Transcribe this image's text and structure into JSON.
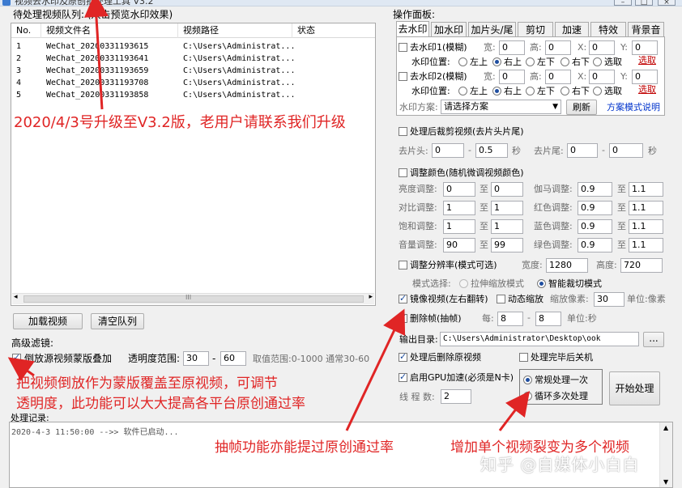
{
  "window": {
    "title": "视频去水印及原创批处理工具 V3.2"
  },
  "queue": {
    "label": "待处理视频队列: (双击预览水印效果)",
    "columns": [
      "No.",
      "视频文件名",
      "视频路径",
      "状态"
    ],
    "rows": [
      [
        "1",
        "WeChat_20200331193615",
        "C:\\Users\\Administrat...",
        ""
      ],
      [
        "2",
        "WeChat_20200331193641",
        "C:\\Users\\Administrat...",
        ""
      ],
      [
        "3",
        "WeChat_20200331193659",
        "C:\\Users\\Administrat...",
        ""
      ],
      [
        "4",
        "WeChat_20200331193708",
        "C:\\Users\\Administrat...",
        ""
      ],
      [
        "5",
        "WeChat_20200331193858",
        "C:\\Users\\Administrat...",
        ""
      ]
    ],
    "scroll_mark": "III",
    "load_button": "加载视频",
    "clear_button": "清空队列"
  },
  "advanced": {
    "label": "高级滤镜:",
    "reverse_overlay": {
      "label": "倒放源视频蒙版叠加",
      "checked": true
    },
    "opacity_label": "透明度范围:",
    "opacity_min": "30",
    "dash": "-",
    "opacity_max": "60",
    "range_hint": "取值范围:0-1000 通常30-60"
  },
  "ops": {
    "label": "操作面板:",
    "tabs": [
      "去水印",
      "加水印",
      "加片头/尾",
      "剪切",
      "加速",
      "特效",
      "背景音"
    ],
    "active_tab": "去水印",
    "wm1": {
      "label": "去水印1(模糊)",
      "w_label": "宽:",
      "w": "0",
      "h_label": "高:",
      "h": "0",
      "x_label": "X:",
      "x": "0",
      "y_label": "Y:",
      "y": "0"
    },
    "wm2": {
      "label": "去水印2(模糊)",
      "w_label": "宽:",
      "w": "0",
      "h_label": "高:",
      "h": "0",
      "x_label": "X:",
      "x": "0",
      "y_label": "Y:",
      "y": "0"
    },
    "pos_label": "水印位置:",
    "positions": [
      "左上",
      "右上",
      "左下",
      "右下",
      "选取"
    ],
    "pick_link": "选取",
    "scheme_label": "水印方案:",
    "scheme_value": "请选择方案",
    "refresh_button": "刷新",
    "scheme_help": "方案模式说明"
  },
  "trim": {
    "label": "处理后裁剪视频(去片头片尾)",
    "head_label": "去片头:",
    "head_from": "0",
    "head_to": "0.5",
    "sec": "秒",
    "tail_label": "去片尾:",
    "tail_from": "0",
    "tail_to": "0"
  },
  "color": {
    "label": "调整颜色(随机微调视频颜色)",
    "to": "至",
    "rows": [
      {
        "l": "亮度调整:",
        "a": "0",
        "b": "0",
        "l2": "伽马调整:",
        "c": "0.9",
        "d": "1.1"
      },
      {
        "l": "对比调整:",
        "a": "1",
        "b": "1",
        "l2": "红色调整:",
        "c": "0.9",
        "d": "1.1"
      },
      {
        "l": "饱和调整:",
        "a": "1",
        "b": "1",
        "l2": "蓝色调整:",
        "c": "0.9",
        "d": "1.1"
      },
      {
        "l": "音量调整:",
        "a": "90",
        "b": "99",
        "l2": "绿色调整:",
        "c": "0.9",
        "d": "1.1"
      }
    ]
  },
  "resolution": {
    "label": "调整分辨率(模式可选)",
    "width_label": "宽度:",
    "width": "1280",
    "height_label": "高度:",
    "height": "720",
    "mode_label": "模式选择:",
    "mode_stretch": "拉伸缩放模式",
    "mode_smart": "智能裁切模式"
  },
  "mirror": {
    "label": "镜像视频(左右翻转)",
    "checked": true,
    "dynamic_label": "动态缩放",
    "zoom_label": "缩放像素:",
    "zoom": "30",
    "unit": "单位:像素"
  },
  "frames": {
    "label": "删除帧(抽帧)",
    "checked": true,
    "every_label": "每:",
    "a": "8",
    "dash": "-",
    "b": "8",
    "unit": "单位:秒"
  },
  "output": {
    "label": "输出目录:",
    "path": "C:\\Users\\Administrator\\Desktop\\ook",
    "browse": "..."
  },
  "after": {
    "delete_label": "处理后删除原视频",
    "delete_checked": true,
    "shutdown_label": "处理完毕后关机"
  },
  "gpu": {
    "label": "启用GPU加速(必须是N卡)",
    "checked": true,
    "threads_label": "线 程 数:",
    "threads": "2"
  },
  "mode": {
    "normal": "常规处理一次",
    "loop": "循环多次处理"
  },
  "start_button": "开始处理",
  "log": {
    "label": "处理记录:",
    "line": "2020-4-3 11:50:00 -->> 软件已启动..."
  },
  "annotations": {
    "upgrade": "2020/4/3号升级至V3.2版，老用户请联系我们升级",
    "reverse_line1": "把视频倒放作为蒙版覆盖至原视频，可调节",
    "reverse_line2": "透明度，此功能可以大大提高各平台原创通过率",
    "frames": "抽帧功能亦能提过原创通过率",
    "multi": "增加单个视频裂变为多个视频"
  },
  "watermark": "知乎 @自媒体小白白",
  "colors": {
    "annotation": "#e02525",
    "link_red": "#c00000",
    "link_blue": "#0033cc"
  }
}
